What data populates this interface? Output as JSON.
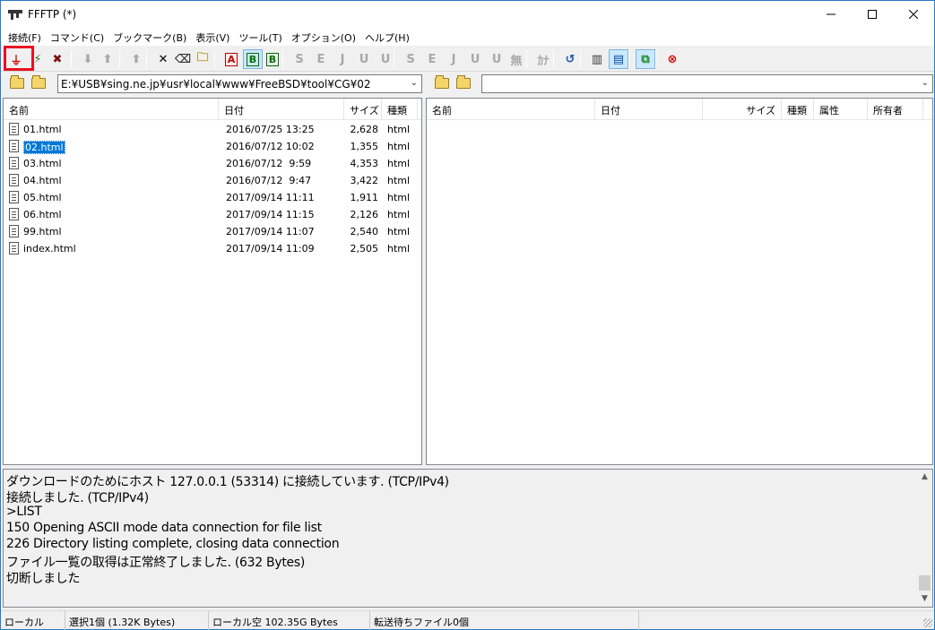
{
  "window": {
    "title": "FFFTP (*)"
  },
  "menu": [
    "接続(F)",
    "コマンド(C)",
    "ブックマーク(B)",
    "表示(V)",
    "ツール(T)",
    "オプション(O)",
    "ヘルプ(H)"
  ],
  "toolbar": {
    "buttons": [
      {
        "id": "connect",
        "glyph": "⏚",
        "icon": "plug-connect-icon",
        "enabled": true
      },
      {
        "id": "quick-connect",
        "glyph": "⚡",
        "icon": "quick-connect-icon",
        "enabled": true
      },
      {
        "id": "disconnect",
        "glyph": "✖",
        "icon": "disconnect-icon",
        "enabled": true
      },
      {
        "id": "download",
        "glyph": "⬇",
        "icon": "download-icon",
        "enabled": false
      },
      {
        "id": "upload",
        "glyph": "⬆",
        "icon": "upload-icon",
        "enabled": false
      },
      {
        "id": "mirror-upload",
        "glyph": "⬆",
        "icon": "mirror-upload-icon",
        "enabled": false
      },
      {
        "id": "delete",
        "glyph": "✕",
        "icon": "delete-icon",
        "enabled": true
      },
      {
        "id": "rename",
        "glyph": "⌫",
        "icon": "rename-icon",
        "enabled": true
      },
      {
        "id": "mkdir",
        "glyph": "🗀",
        "icon": "new-folder-icon",
        "enabled": true
      },
      {
        "id": "ascii-mode",
        "glyph": "A",
        "icon": "ascii-mode-icon",
        "enabled": true
      },
      {
        "id": "binary-mode",
        "glyph": "B",
        "icon": "binary-mode-icon",
        "enabled": true
      },
      {
        "id": "auto-mode",
        "glyph": "B",
        "icon": "auto-mode-icon",
        "enabled": true
      },
      {
        "id": "sjis",
        "glyph": "S",
        "icon": "sjis-icon",
        "enabled": false
      },
      {
        "id": "euc",
        "glyph": "E",
        "icon": "euc-icon",
        "enabled": false
      },
      {
        "id": "jis",
        "glyph": "J",
        "icon": "jis-icon",
        "enabled": false
      },
      {
        "id": "utf8",
        "glyph": "U",
        "icon": "utf8-icon",
        "enabled": false
      },
      {
        "id": "utf8bom",
        "glyph": "U",
        "icon": "utf8-bom-icon",
        "enabled": false
      },
      {
        "id": "sjis2",
        "glyph": "S",
        "icon": "sjis-local-icon",
        "enabled": false
      },
      {
        "id": "euc2",
        "glyph": "E",
        "icon": "euc-local-icon",
        "enabled": false
      },
      {
        "id": "jis2",
        "glyph": "J",
        "icon": "jis-local-icon",
        "enabled": false
      },
      {
        "id": "utf8-2",
        "glyph": "U",
        "icon": "utf8-local-icon",
        "enabled": false
      },
      {
        "id": "utf8bom2",
        "glyph": "U",
        "icon": "utf8-bom-local-icon",
        "enabled": false
      },
      {
        "id": "no-conv",
        "glyph": "無",
        "icon": "no-convert-icon",
        "enabled": false
      },
      {
        "id": "kana",
        "glyph": "ｶﾅ",
        "icon": "kana-convert-icon",
        "enabled": false
      },
      {
        "id": "refresh",
        "glyph": "↺",
        "icon": "refresh-icon",
        "enabled": true
      },
      {
        "id": "list-view",
        "glyph": "▥",
        "icon": "list-view-icon",
        "enabled": true
      },
      {
        "id": "detail-view",
        "glyph": "▤",
        "icon": "detail-view-icon",
        "enabled": true
      },
      {
        "id": "sync-dir",
        "glyph": "⧉",
        "icon": "sync-folder-icon",
        "enabled": true
      },
      {
        "id": "stop",
        "glyph": "⊗",
        "icon": "stop-icon",
        "enabled": true
      }
    ]
  },
  "local": {
    "path": "E:¥USB¥sing.ne.jp¥usr¥local¥www¥FreeBSD¥tool¥CG¥02",
    "columns": [
      "名前",
      "日付",
      "サイズ",
      "種類"
    ],
    "files": [
      {
        "name": "01.html",
        "date": "2016/07/25 13:25",
        "size": "2,628",
        "type": "html",
        "selected": false
      },
      {
        "name": "02.html",
        "date": "2016/07/12 10:02",
        "size": "1,355",
        "type": "html",
        "selected": true
      },
      {
        "name": "03.html",
        "date": "2016/07/12  9:59",
        "size": "4,353",
        "type": "html",
        "selected": false
      },
      {
        "name": "04.html",
        "date": "2016/07/12  9:47",
        "size": "3,422",
        "type": "html",
        "selected": false
      },
      {
        "name": "05.html",
        "date": "2017/09/14 11:11",
        "size": "1,911",
        "type": "html",
        "selected": false
      },
      {
        "name": "06.html",
        "date": "2017/09/14 11:15",
        "size": "2,126",
        "type": "html",
        "selected": false
      },
      {
        "name": "99.html",
        "date": "2017/09/14 11:07",
        "size": "2,540",
        "type": "html",
        "selected": false
      },
      {
        "name": "index.html",
        "date": "2017/09/14 11:09",
        "size": "2,505",
        "type": "html",
        "selected": false
      }
    ]
  },
  "remote": {
    "path": "",
    "columns": [
      "名前",
      "日付",
      "サイズ",
      "種類",
      "属性",
      "所有者"
    ]
  },
  "log": [
    "ダウンロードのためにホスト 127.0.0.1 (53314) に接続しています. (TCP/IPv4)",
    "接続しました. (TCP/IPv4)",
    ">LIST",
    "150 Opening ASCII mode data connection for file list",
    "226 Directory listing complete, closing data connection",
    "ファイル一覧の取得は正常終了しました. (632 Bytes)",
    "切断しました"
  ],
  "status": {
    "mode": "ローカル",
    "selection": "選択1個 (1.32K Bytes)",
    "free": "ローカル空 102.35G Bytes",
    "queue": "転送待ちファイル0個"
  },
  "colors": {
    "selection": "#0078d7",
    "highlight": "#e81123"
  }
}
